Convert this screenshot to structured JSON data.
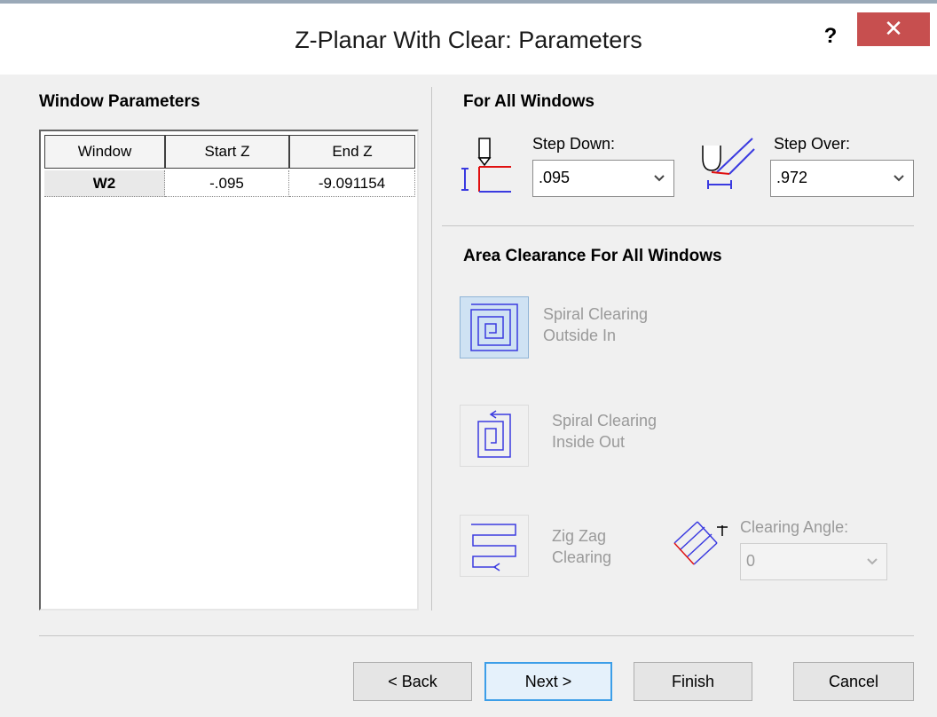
{
  "dialog": {
    "title": "Z-Planar With Clear: Parameters",
    "help_label": "?",
    "close_label": "✕"
  },
  "window_parameters": {
    "heading": "Window Parameters",
    "columns": [
      "Window",
      "Start Z",
      "End Z"
    ],
    "rows": [
      {
        "window": "W2",
        "start_z": "-.095",
        "end_z": "-9.091154"
      }
    ]
  },
  "for_all_windows": {
    "heading": "For All Windows",
    "step_down": {
      "label": "Step Down:",
      "value": ".095",
      "icon": "step-down-icon"
    },
    "step_over": {
      "label": "Step Over:",
      "value": ".972",
      "icon": "step-over-icon"
    }
  },
  "area_clearance": {
    "heading": "Area Clearance For All Windows",
    "options": [
      {
        "line1": "Spiral Clearing",
        "line2": "Outside In",
        "icon": "spiral-outside-in-icon",
        "selected": true,
        "enabled": false
      },
      {
        "line1": "Spiral Clearing",
        "line2": "Inside Out",
        "icon": "spiral-inside-out-icon",
        "selected": false,
        "enabled": false
      },
      {
        "line1": "Zig Zag",
        "line2": "Clearing",
        "icon": "zig-zag-icon",
        "selected": false,
        "enabled": false
      }
    ],
    "clearing_angle": {
      "label": "Clearing Angle:",
      "value": "0",
      "enabled": false,
      "icon": "clearing-angle-icon"
    }
  },
  "buttons": {
    "back": "< Back",
    "next": "Next >",
    "finish": "Finish",
    "cancel": "Cancel"
  },
  "colors": {
    "accent": "#3c9ee8",
    "close_button": "#c74f4f",
    "icon_blue": "#3a3ae0",
    "icon_red": "#e01010",
    "selected_fill": "#cfe2f3"
  }
}
